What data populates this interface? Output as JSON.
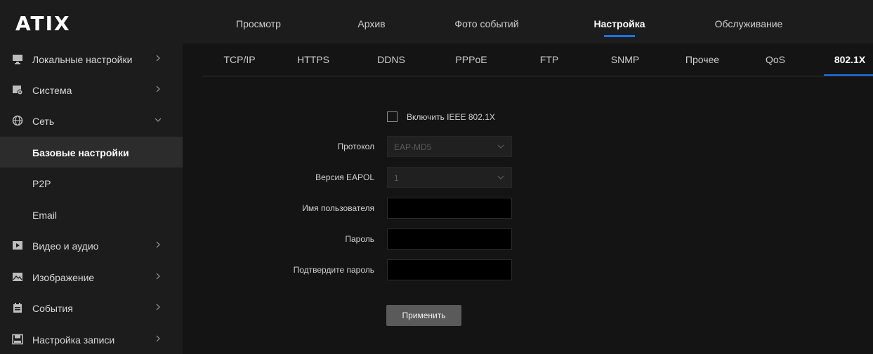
{
  "brand": {
    "logo_text": "ATIX"
  },
  "top_nav": {
    "items": [
      "Просмотр",
      "Архив",
      "Фото событий",
      "Настройка",
      "Обслуживание"
    ],
    "active": "Настройка"
  },
  "sidebar": {
    "items": [
      {
        "label": "Локальные настройки",
        "icon": "monitor-icon",
        "chevron": "right"
      },
      {
        "label": "Система",
        "icon": "system-gear-icon",
        "chevron": "right"
      },
      {
        "label": "Сеть",
        "icon": "network-globe-icon",
        "chevron": "down"
      },
      {
        "label": "Базовые настройки",
        "sub": true,
        "active": true
      },
      {
        "label": "P2P",
        "sub": true
      },
      {
        "label": "Email",
        "sub": true
      },
      {
        "label": "Видео и аудио",
        "icon": "video-play-icon",
        "chevron": "right"
      },
      {
        "label": "Изображение",
        "icon": "image-icon",
        "chevron": "right"
      },
      {
        "label": "События",
        "icon": "events-calendar-icon",
        "chevron": "right"
      },
      {
        "label": "Настройка записи",
        "icon": "storage-icon",
        "chevron": "right"
      }
    ]
  },
  "subtabs": {
    "items": [
      "TCP/IP",
      "HTTPS",
      "DDNS",
      "PPPoE",
      "FTP",
      "SNMP",
      "Прочее",
      "QoS",
      "802.1X"
    ],
    "active": "802.1X"
  },
  "form": {
    "enable_label": "Включить IEEE 802.1X",
    "enable_checked": false,
    "protocol_label": "Протокол",
    "protocol_value": "EAP-MD5",
    "eapol_label": "Версия EAPOL",
    "eapol_value": "1",
    "username_label": "Имя пользователя",
    "username_value": "",
    "password_label": "Пароль",
    "password_value": "",
    "confirm_label": "Подтвердите пароль",
    "confirm_value": "",
    "apply_label": "Применить"
  },
  "colors": {
    "accent": "#1a73e8",
    "sidebar_bg": "#1c1c1c",
    "content_bg": "#141414",
    "button_bg": "#5a5a5a"
  }
}
